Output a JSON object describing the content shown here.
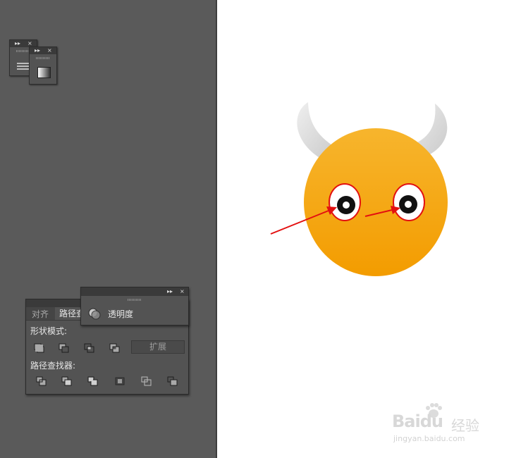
{
  "collapsed_panel_back": {
    "collapse_glyph": "▸▸",
    "close_glyph": "×",
    "icon": "menu-lines-icon"
  },
  "collapsed_panel_front": {
    "collapse_glyph": "▸▸",
    "close_glyph": "×",
    "icon": "gradient-swatch-icon"
  },
  "pathfinder_panel": {
    "tabs": [
      {
        "label": "对齐"
      },
      {
        "label": "路径查"
      }
    ],
    "shape_modes_label": "形状模式:",
    "shape_mode_icons": [
      "unite-icon",
      "minus-front-icon",
      "intersect-icon",
      "exclude-icon"
    ],
    "expand_button": "扩展",
    "pathfinders_label": "路径查找器:",
    "pathfinder_icons": [
      "divide-icon",
      "trim-icon",
      "merge-icon",
      "crop-icon",
      "outline-icon",
      "minus-back-icon"
    ]
  },
  "transparency_panel": {
    "collapse_glyph": "▸▸",
    "close_glyph": "×",
    "icon": "transparency-icon",
    "label": "透明度"
  },
  "artwork": {
    "face_color_top": "#f7b52d",
    "face_color_bottom": "#f39c00",
    "horn_color": "#dcdcdc",
    "arrow_color": "#e31010"
  },
  "watermark": {
    "brand": "Baidu",
    "product": "经验",
    "url": "jingyan.baidu.com"
  }
}
